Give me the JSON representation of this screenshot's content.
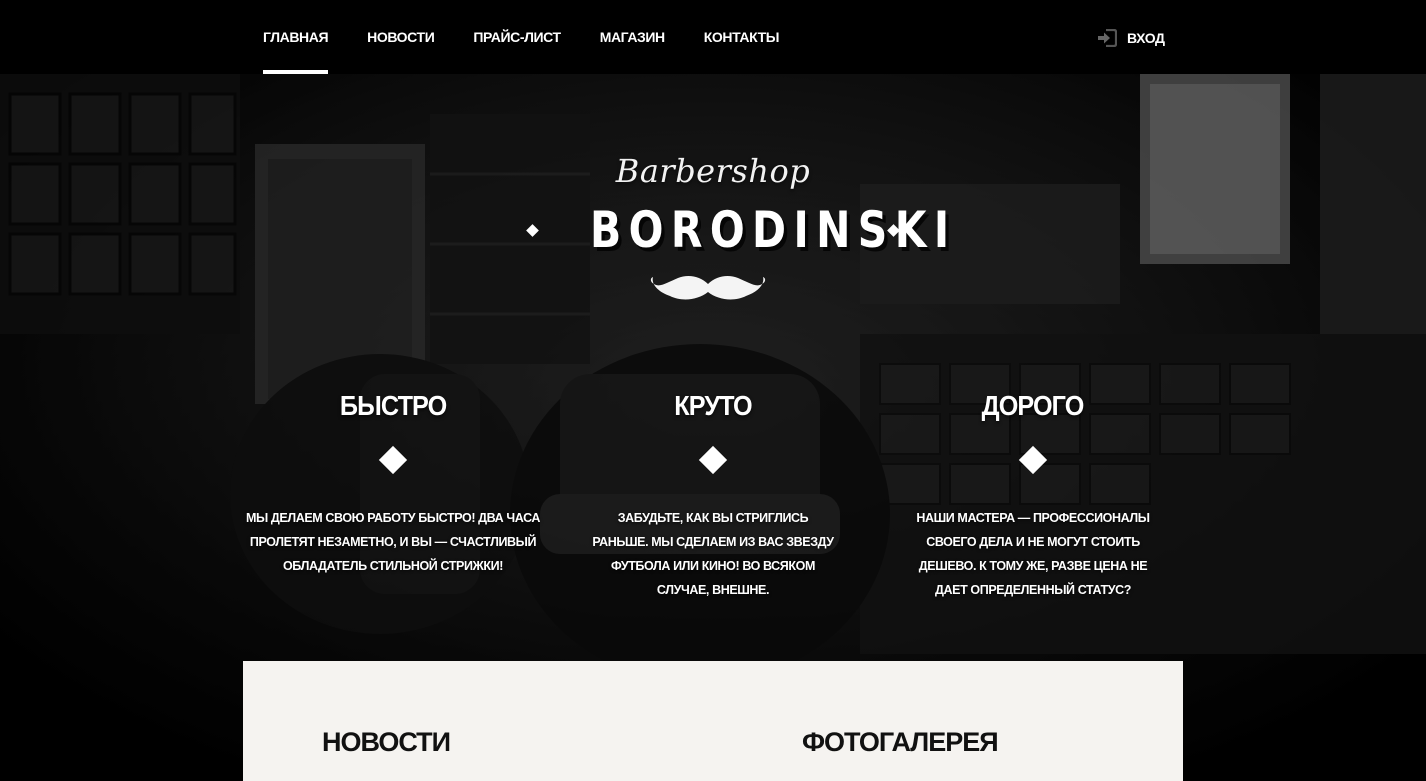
{
  "nav": {
    "items": [
      {
        "label": "ГЛАВНАЯ",
        "active": true
      },
      {
        "label": "НОВОСТИ",
        "active": false
      },
      {
        "label": "ПРАЙС-ЛИСТ",
        "active": false
      },
      {
        "label": "МАГАЗИН",
        "active": false
      },
      {
        "label": "КОНТАКТЫ",
        "active": false
      }
    ],
    "login": {
      "label": "ВХОД",
      "icon": "sign-in-icon"
    }
  },
  "hero": {
    "brand_script": "Barbershop",
    "brand_name": "BORODINSKI",
    "logo_icon": "mustache-icon",
    "features": [
      {
        "title": "БЫСТРО",
        "text": "МЫ ДЕЛАЕМ СВОЮ РАБОТУ БЫСТРО! ДВА ЧАСА ПРОЛЕТЯТ НЕЗАМЕТНО, И ВЫ — СЧАСТЛИВЫЙ ОБЛАДАТЕЛЬ СТИЛЬНОЙ СТРИЖКИ!"
      },
      {
        "title": "КРУТО",
        "text": "ЗАБУДЬТЕ, КАК ВЫ СТРИГЛИСЬ РАНЬШЕ. МЫ СДЕЛАЕМ ИЗ ВАС ЗВЕЗДУ ФУТБОЛА ИЛИ КИНО! ВО ВСЯКОМ СЛУЧАЕ, ВНЕШНЕ."
      },
      {
        "title": "ДОРОГО",
        "text": "НАШИ МАСТЕРА — ПРОФЕССИОНАЛЫ СВОЕГО ДЕЛА И НЕ МОГУТ СТОИТЬ ДЕШЕВО. К ТОМУ ЖЕ, РАЗВЕ ЦЕНА НЕ ДАЕТ ОПРЕДЕЛЕННЫЙ СТАТУС?"
      }
    ]
  },
  "sections": {
    "news_title": "НОВОСТИ",
    "gallery_title": "ФОТОГАЛЕРЕЯ"
  },
  "colors": {
    "nav_bg": "#000000",
    "text": "#ffffff",
    "panel_bg": "#f5f3f0",
    "panel_text": "#111111"
  }
}
